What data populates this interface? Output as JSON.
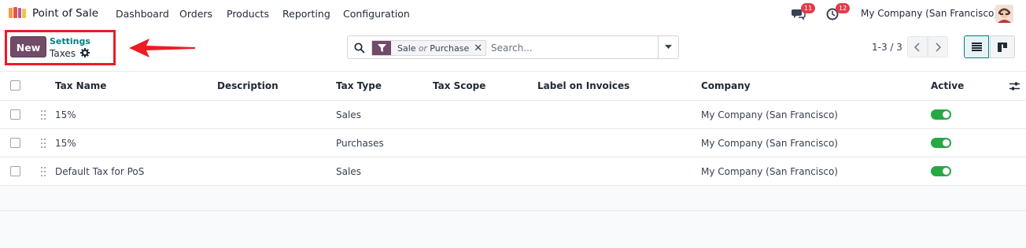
{
  "navbar": {
    "app_name": "Point of Sale",
    "menu": [
      "Dashboard",
      "Orders",
      "Products",
      "Reporting",
      "Configuration"
    ],
    "messages_count": "11",
    "activities_count": "12",
    "company": "My Company (San Francisco)"
  },
  "control_panel": {
    "new_label": "New",
    "breadcrumb_parent": "Settings",
    "breadcrumb_current": "Taxes",
    "search": {
      "facet_value_1": "Sale",
      "facet_separator": "or",
      "facet_value_2": "Purchase",
      "placeholder": "Search..."
    },
    "pager": "1-3 / 3"
  },
  "list": {
    "columns": [
      "Tax Name",
      "Description",
      "Tax Type",
      "Tax Scope",
      "Label on Invoices",
      "Company",
      "Active"
    ],
    "rows": [
      {
        "name": "15%",
        "description": "",
        "type": "Sales",
        "scope": "",
        "label": "",
        "company": "My Company (San Francisco)",
        "active": true
      },
      {
        "name": "15%",
        "description": "",
        "type": "Purchases",
        "scope": "",
        "label": "",
        "company": "My Company (San Francisco)",
        "active": true
      },
      {
        "name": "Default Tax for PoS",
        "description": "",
        "type": "Sales",
        "scope": "",
        "label": "",
        "company": "My Company (San Francisco)",
        "active": true
      }
    ]
  },
  "colors": {
    "brand": "#714b67",
    "link": "#017e84",
    "toggle_on": "#28a745",
    "badge": "#e33b48",
    "annotation": "#ee1b24"
  }
}
